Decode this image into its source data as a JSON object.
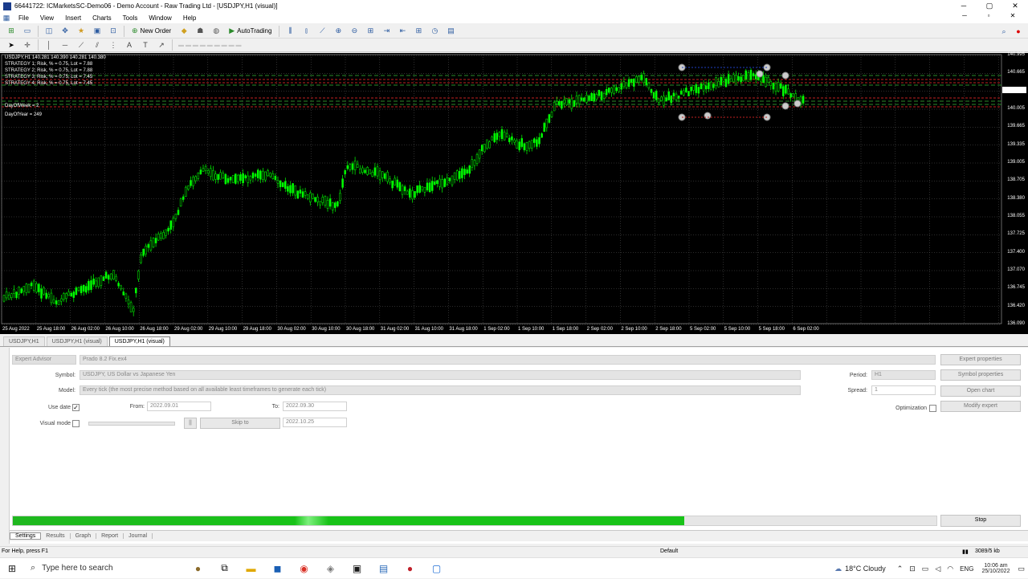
{
  "titlebar": {
    "title": "66441722: ICMarketsSC-Demo06 - Demo Account - Raw Trading Ltd - [USDJPY,H1 (visual)]",
    "minimize": "─",
    "maximize": "▢",
    "close": "✕"
  },
  "menu": {
    "items": [
      "File",
      "View",
      "Insert",
      "Charts",
      "Tools",
      "Window",
      "Help"
    ],
    "mdi": [
      "─",
      "▫",
      "✕"
    ]
  },
  "toolbar": {
    "new_order": "New Order",
    "auto_trading": "AutoTrading"
  },
  "chart": {
    "symbol_line": "USDJPY,H1 140.281 140.390 140.281 140.380",
    "strategy_lines": [
      "STRATEGY 1; Risk, % = 0.75, Lot = 7.88",
      "STRATEGY 2; Risk, % = 0.75, Lot = 7.88",
      "STRATEGY 3; Risk, % = 0.75, Lot = 7.45",
      "STRATEGY 4; Risk, % = 0.75, Lot = 7.45"
    ],
    "extra_lines": [
      "DayOfWeek = 2",
      "DayOfYear = 249"
    ],
    "price_labels": [
      "140.995",
      "140.665",
      "140.380",
      "140.005",
      "139.665",
      "139.335",
      "139.005",
      "138.705",
      "138.380",
      "138.055",
      "137.725",
      "137.400",
      "137.070",
      "136.745",
      "136.420",
      "136.090"
    ],
    "time_labels": [
      "25 Aug 2022",
      "25 Aug 18:00",
      "26 Aug 02:00",
      "26 Aug 10:00",
      "26 Aug 18:00",
      "29 Aug 02:00",
      "29 Aug 10:00",
      "29 Aug 18:00",
      "30 Aug 02:00",
      "30 Aug 10:00",
      "30 Aug 18:00",
      "31 Aug 02:00",
      "31 Aug 10:00",
      "31 Aug 18:00",
      "1 Sep 02:00",
      "1 Sep 10:00",
      "1 Sep 18:00",
      "2 Sep 02:00",
      "2 Sep 10:00",
      "2 Sep 18:00",
      "5 Sep 02:00",
      "5 Sep 10:00",
      "5 Sep 18:00",
      "6 Sep 02:00"
    ],
    "candle_color": "#00ff00",
    "background": "#000000"
  },
  "chart_tabs": [
    "USDJPY,H1",
    "USDJPY,H1 (visual)",
    "USDJPY,H1 (visual)"
  ],
  "tester": {
    "expert_advisor_label": "Expert Advisor",
    "expert_value": "Prado 8.2 Fix.ex4",
    "symbol_label": "Symbol:",
    "symbol_value": "USDJPY, US Dollar vs Japanese Yen",
    "model_label": "Model:",
    "model_value": "Every tick (the most precise method based on all available least timeframes to generate each tick)",
    "use_date_label": "Use date",
    "use_date_checked": "✓",
    "from_label": "From:",
    "from_value": "2022.09.01",
    "to_label": "To:",
    "to_value": "2022.09.30",
    "visual_mode_label": "Visual mode",
    "pause_label": "||",
    "skip_to_label": "Skip to",
    "skip_to_value": "2022.10.25",
    "period_label": "Period:",
    "period_value": "H1",
    "spread_label": "Spread:",
    "spread_value": "1",
    "optimization_label": "Optimization",
    "expert_properties": "Expert properties",
    "symbol_properties": "Symbol properties",
    "open_chart": "Open chart",
    "modify_expert": "Modify expert",
    "progress": 0.727,
    "stop": "Stop"
  },
  "bottom_tabs": [
    "Settings",
    "Results",
    "Graph",
    "Report",
    "Journal"
  ],
  "statusbar": {
    "help": "For Help, press F1",
    "profile": "Default",
    "traffic": "3089/5 kb"
  },
  "taskbar": {
    "search_placeholder": "Type here to search",
    "weather": "18°C  Cloudy",
    "lang": "ENG",
    "time": "10:06 am",
    "date": "25/10/2022"
  }
}
